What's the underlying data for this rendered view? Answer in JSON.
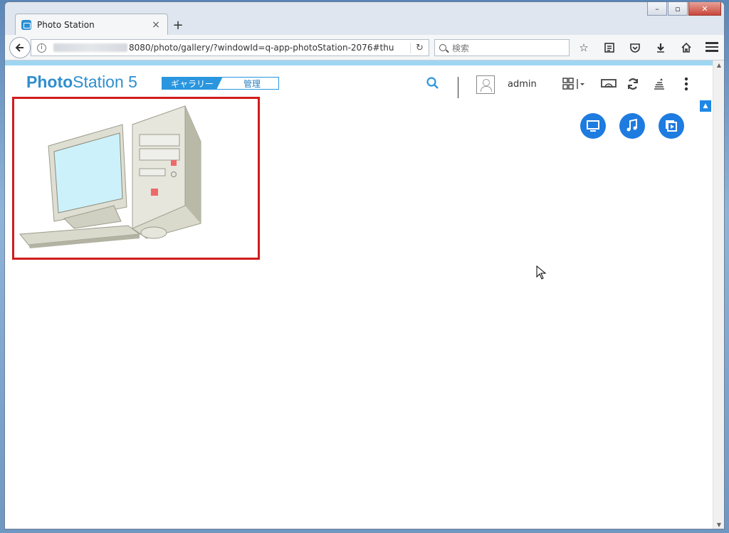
{
  "browser": {
    "tab_title": "Photo Station",
    "tab_close": "×",
    "new_tab": "+",
    "url_suffix": "8080/photo/gallery/?windowId=q-app-photoStation-2076#thu",
    "search_placeholder": "検索",
    "caption": {
      "minimize": "–",
      "maximize": "▫",
      "close": "✕"
    }
  },
  "app": {
    "brand_bold": "Photo",
    "brand_rest": "Station 5",
    "tabs": [
      {
        "label": "ギャラリー",
        "active": true
      },
      {
        "label": "管理",
        "active": false
      }
    ],
    "username": "admin"
  },
  "colors": {
    "accent": "#2a96df",
    "selection_border": "#d21c1c",
    "action_button": "#1e7be0",
    "accent_strip": "#9ed6f2"
  },
  "icons": {
    "header": [
      "search-icon",
      "user-avatar-icon",
      "view-grid-icon",
      "cast-icon",
      "refresh-icon",
      "upload-icon",
      "more-icon"
    ],
    "actions": [
      "slideshow-icon",
      "music-icon",
      "video-icon"
    ]
  },
  "thumbnail": {
    "subject": "desktop-computer-illustration"
  }
}
